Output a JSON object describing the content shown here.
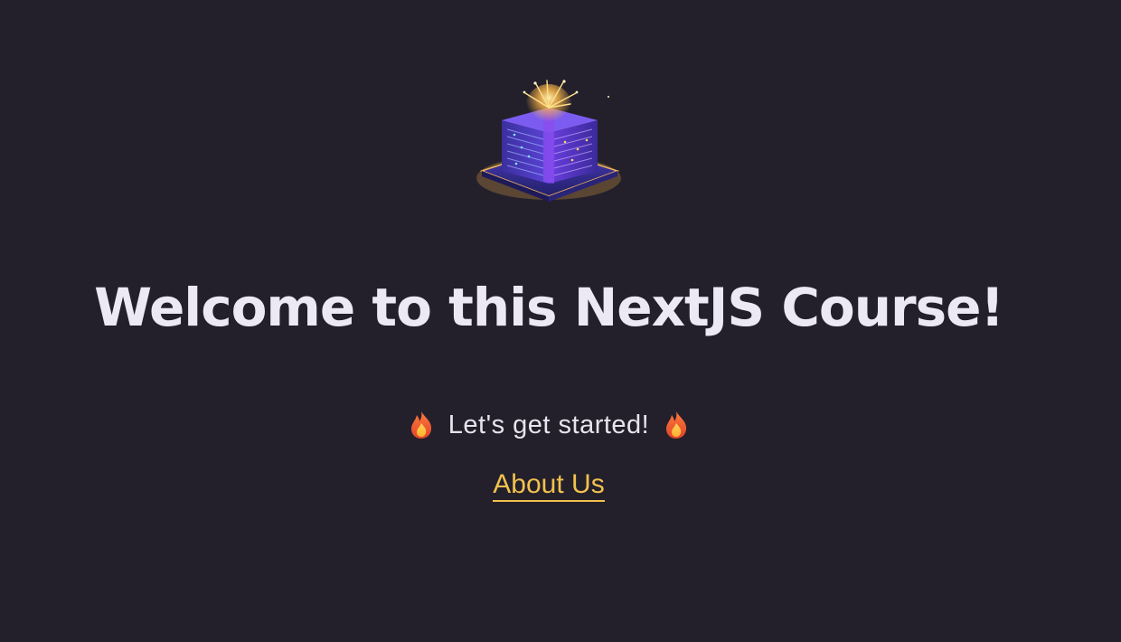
{
  "hero": {
    "logo_icon": "server-gift-icon"
  },
  "title": "Welcome to this NextJS Course!",
  "tagline": {
    "text": "Let's get started!",
    "icon": "fire-icon"
  },
  "nav": {
    "about_label": "About Us"
  },
  "colors": {
    "background": "#23202b",
    "title": "#ece9f5",
    "link": "#f2c14e",
    "accent_purple": "#6f3bd8",
    "glow": "#ffb84a"
  }
}
